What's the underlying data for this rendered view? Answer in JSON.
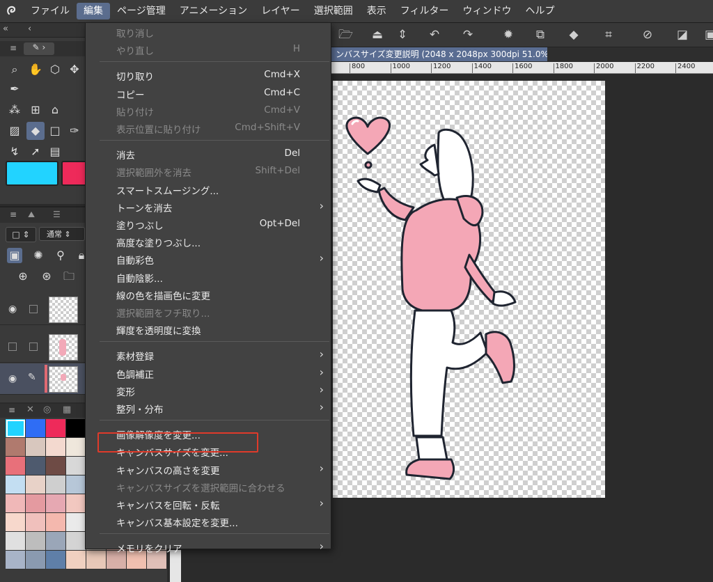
{
  "menubar": {
    "items": [
      "ファイル",
      "編集",
      "ページ管理",
      "アニメーション",
      "レイヤー",
      "選択範囲",
      "表示",
      "フィルター",
      "ウィンドウ",
      "ヘルプ"
    ],
    "active_index": 1
  },
  "document": {
    "tab_title": "ンバスサイズ変更説明 (2048 x 2048px 300dpi 51.0%)",
    "ruler_labels": [
      "800",
      "1000",
      "1200",
      "1400",
      "1600",
      "1800",
      "2000",
      "2200",
      "2400"
    ]
  },
  "layer_panel": {
    "blend_mode": "通常"
  },
  "colors": {
    "main_color": "#22d3ff",
    "sub_color": "#ee2a5a",
    "highlight": "#e03a2a",
    "menu_active": "#5b6d8e"
  },
  "edit_menu": {
    "items": [
      {
        "label": "取り消し",
        "shortcut": "",
        "disabled": true,
        "submenu": false
      },
      {
        "label": "やり直し",
        "shortcut": "H",
        "disabled": true,
        "submenu": false
      },
      {
        "sep": true
      },
      {
        "label": "切り取り",
        "shortcut": "Cmd+X",
        "disabled": false,
        "submenu": false
      },
      {
        "label": "コピー",
        "shortcut": "Cmd+C",
        "disabled": false,
        "submenu": false
      },
      {
        "label": "貼り付け",
        "shortcut": "Cmd+V",
        "disabled": true,
        "submenu": false
      },
      {
        "label": "表示位置に貼り付け",
        "shortcut": "Cmd+Shift+V",
        "disabled": true,
        "submenu": false
      },
      {
        "sep": true
      },
      {
        "label": "消去",
        "shortcut": "Del",
        "disabled": false,
        "submenu": false
      },
      {
        "label": "選択範囲外を消去",
        "shortcut": "Shift+Del",
        "disabled": true,
        "submenu": false
      },
      {
        "label": "スマートスムージング...",
        "shortcut": "",
        "disabled": false,
        "submenu": false
      },
      {
        "label": "トーンを消去",
        "shortcut": "",
        "disabled": false,
        "submenu": true
      },
      {
        "label": "塗りつぶし",
        "shortcut": "Opt+Del",
        "disabled": false,
        "submenu": false
      },
      {
        "label": "高度な塗りつぶし...",
        "shortcut": "",
        "disabled": false,
        "submenu": false
      },
      {
        "label": "自動彩色",
        "shortcut": "",
        "disabled": false,
        "submenu": true
      },
      {
        "label": "自動陰影...",
        "shortcut": "",
        "disabled": false,
        "submenu": false
      },
      {
        "label": "線の色を描画色に変更",
        "shortcut": "",
        "disabled": false,
        "submenu": false
      },
      {
        "label": "選択範囲をフチ取り...",
        "shortcut": "",
        "disabled": true,
        "submenu": false
      },
      {
        "label": "輝度を透明度に変換",
        "shortcut": "",
        "disabled": false,
        "submenu": false
      },
      {
        "sep": true
      },
      {
        "label": "素材登録",
        "shortcut": "",
        "disabled": false,
        "submenu": true
      },
      {
        "label": "色調補正",
        "shortcut": "",
        "disabled": false,
        "submenu": true
      },
      {
        "label": "変形",
        "shortcut": "",
        "disabled": false,
        "submenu": true
      },
      {
        "label": "整列・分布",
        "shortcut": "",
        "disabled": false,
        "submenu": true
      },
      {
        "sep": true
      },
      {
        "label": "画像解像度を変更...",
        "shortcut": "",
        "disabled": false,
        "submenu": false
      },
      {
        "label": "キャンバスサイズを変更...",
        "shortcut": "",
        "disabled": false,
        "submenu": false,
        "highlighted": true
      },
      {
        "label": "キャンバスの高さを変更",
        "shortcut": "",
        "disabled": false,
        "submenu": true
      },
      {
        "label": "キャンバスサイズを選択範囲に合わせる",
        "shortcut": "",
        "disabled": true,
        "submenu": false
      },
      {
        "label": "キャンバスを回転・反転",
        "shortcut": "",
        "disabled": false,
        "submenu": true
      },
      {
        "label": "キャンバス基本設定を変更...",
        "shortcut": "",
        "disabled": false,
        "submenu": false
      },
      {
        "sep": true
      },
      {
        "label": "メモリをクリア",
        "shortcut": "",
        "disabled": false,
        "submenu": true
      }
    ]
  },
  "palette": [
    "#22d3ff",
    "#2f6df5",
    "#ee2a5a",
    "#000000",
    "#cfcfcf",
    "#e2a0a0",
    "#f0b0b0",
    "#f7d3c3",
    "#b07a6e",
    "#d8c7be",
    "#f3d9cf",
    "#efe7dc",
    "#e7e3d6",
    "#f5c4b7",
    "#e6b2a0",
    "#f7e4d8",
    "#e8707a",
    "#4e5a6e",
    "#6e4b45",
    "#d8d8d8",
    "#d3e0e8",
    "#c5d8e8",
    "#d7c8c0",
    "#e8d8d0",
    "#c3def2",
    "#e8d2c8",
    "#cfcfcf",
    "#b7c7d8",
    "#f0d4cc",
    "#f5e0d8",
    "#e8c8c8",
    "#f2dcd4",
    "#f0b8b8",
    "#e49aa0",
    "#e6a8b2",
    "#f2c8c0",
    "#d9d9d9",
    "#e3e3e3",
    "#c8c8c8",
    "#dcdcdc",
    "#f7d8cc",
    "#f0c0bc",
    "#f4b8ae",
    "#eaeaea",
    "#b4b4b4",
    "#d0c8c0",
    "#c8b8b0",
    "#e0e0e0",
    "#e0e0e0",
    "#bdbdbd",
    "#9aa6b8",
    "#d4d4d4",
    "#c8c0b8",
    "#e8b8b0",
    "#f0a8a0",
    "#e8d0c8",
    "#a8b4c8",
    "#8a9ab0",
    "#5f7fa8",
    "#f0d0c0",
    "#e8c8b8",
    "#d8b0a8",
    "#f0c0b0",
    "#e0c0b8"
  ]
}
